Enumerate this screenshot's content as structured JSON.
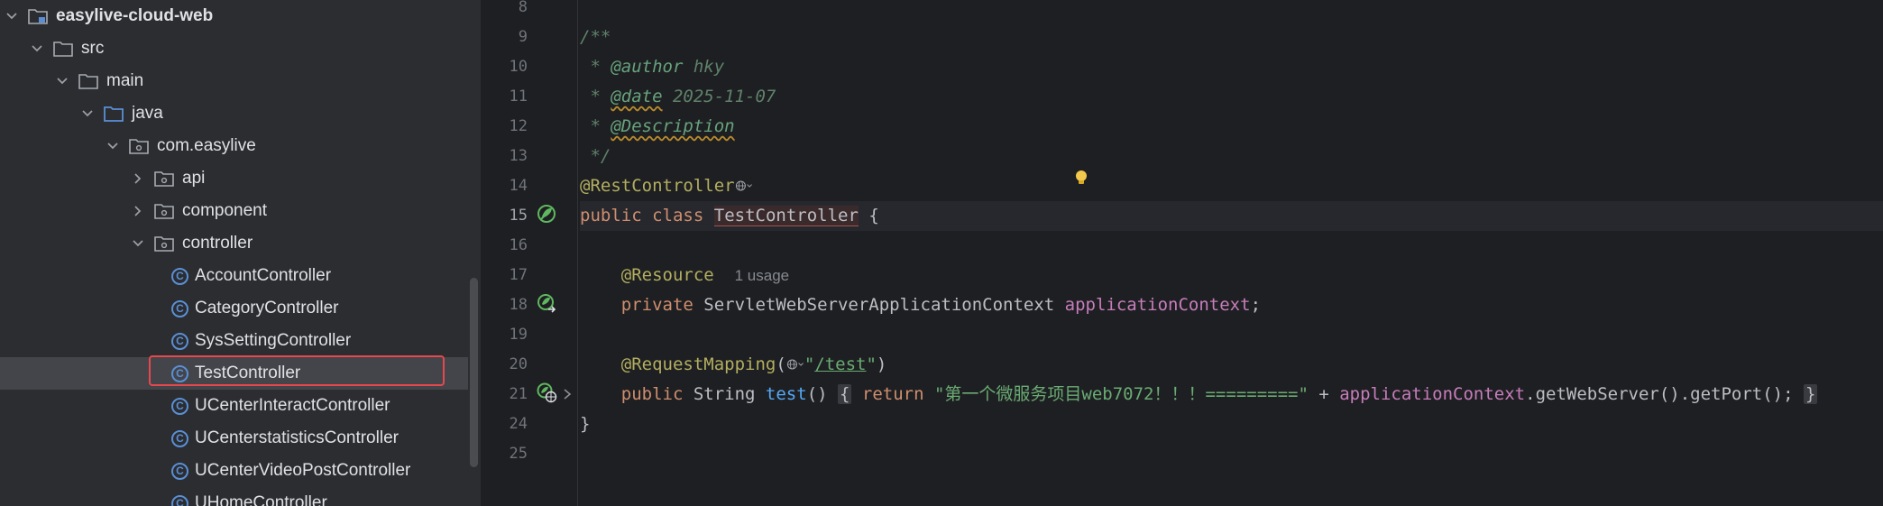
{
  "tree": {
    "items": [
      {
        "label": "easylive-cloud-web",
        "depth": 0,
        "chevron": "down",
        "icon": "module-folder-icon",
        "bold": true
      },
      {
        "label": "src",
        "depth": 1,
        "chevron": "down",
        "icon": "folder-icon"
      },
      {
        "label": "main",
        "depth": 2,
        "chevron": "down",
        "icon": "folder-icon"
      },
      {
        "label": "java",
        "depth": 3,
        "chevron": "down",
        "icon": "source-folder-icon"
      },
      {
        "label": "com.easylive",
        "depth": 4,
        "chevron": "down",
        "icon": "package-icon"
      },
      {
        "label": "api",
        "depth": 5,
        "chevron": "right",
        "icon": "package-icon"
      },
      {
        "label": "component",
        "depth": 5,
        "chevron": "right",
        "icon": "package-icon"
      },
      {
        "label": "controller",
        "depth": 5,
        "chevron": "down",
        "icon": "package-icon"
      },
      {
        "label": "AccountController",
        "depth": 6,
        "chevron": "none",
        "icon": "class-icon"
      },
      {
        "label": "CategoryController",
        "depth": 6,
        "chevron": "none",
        "icon": "class-icon"
      },
      {
        "label": "SysSettingController",
        "depth": 6,
        "chevron": "none",
        "icon": "class-icon"
      },
      {
        "label": "TestController",
        "depth": 6,
        "chevron": "none",
        "icon": "class-icon",
        "selected": true
      },
      {
        "label": "UCenterInteractController",
        "depth": 6,
        "chevron": "none",
        "icon": "class-icon"
      },
      {
        "label": "UCenterstatisticsController",
        "depth": 6,
        "chevron": "none",
        "icon": "class-icon"
      },
      {
        "label": "UCenterVideoPostController",
        "depth": 6,
        "chevron": "none",
        "icon": "class-icon"
      },
      {
        "label": "UHomeController",
        "depth": 6,
        "chevron": "none",
        "icon": "class-icon"
      }
    ]
  },
  "editor": {
    "line_numbers": [
      "8",
      "9",
      "10",
      "11",
      "12",
      "13",
      "14",
      "15",
      "16",
      "17",
      "18",
      "19",
      "20",
      "21",
      "24",
      "25"
    ],
    "current_line": "15",
    "code": {
      "l9": "/**",
      "l10_star": " * ",
      "l10_tag": "@author",
      "l10_rest": " hky",
      "l11_star": " * ",
      "l11_tag": "@date",
      "l11_rest": " 2025-11-07",
      "l12_star": " * ",
      "l12_tag": "@Description",
      "l13": " */",
      "l14_ann": "@RestController",
      "l15_kw1": "public",
      "l15_kw2": "class",
      "l15_name": "TestController",
      "l15_brace": " {",
      "l17_ann": "@Resource",
      "l17_hint": "1 usage",
      "l18_kw": "private",
      "l18_type": " ServletWebServerApplicationContext ",
      "l18_field": "applicationContext",
      "l18_end": ";",
      "l20_ann": "@RequestMapping",
      "l20_paren": "(",
      "l20_q1": "\"",
      "l20_path": "/test",
      "l20_q2": "\"",
      "l20_end": ")",
      "l21_kw": "public",
      "l21_type": " String ",
      "l21_fn": "test",
      "l21_parens": "() ",
      "l21_open": "{",
      "l21_ret": " return ",
      "l21_str": "\"第一个微服务项目web7072！！！=========\"",
      "l21_plus": " + ",
      "l21_field": "applicationContext",
      "l21_call": ".getWebServer().getPort(); ",
      "l21_close": "}",
      "l24": "}"
    }
  },
  "colors": {
    "keyword": "#cf8e6d",
    "annotation": "#b3ae60",
    "doc_comment": "#5f826b",
    "field": "#c77dbb",
    "function": "#56a8f5",
    "string": "#6aab73",
    "selection_outline": "#e5484d"
  }
}
